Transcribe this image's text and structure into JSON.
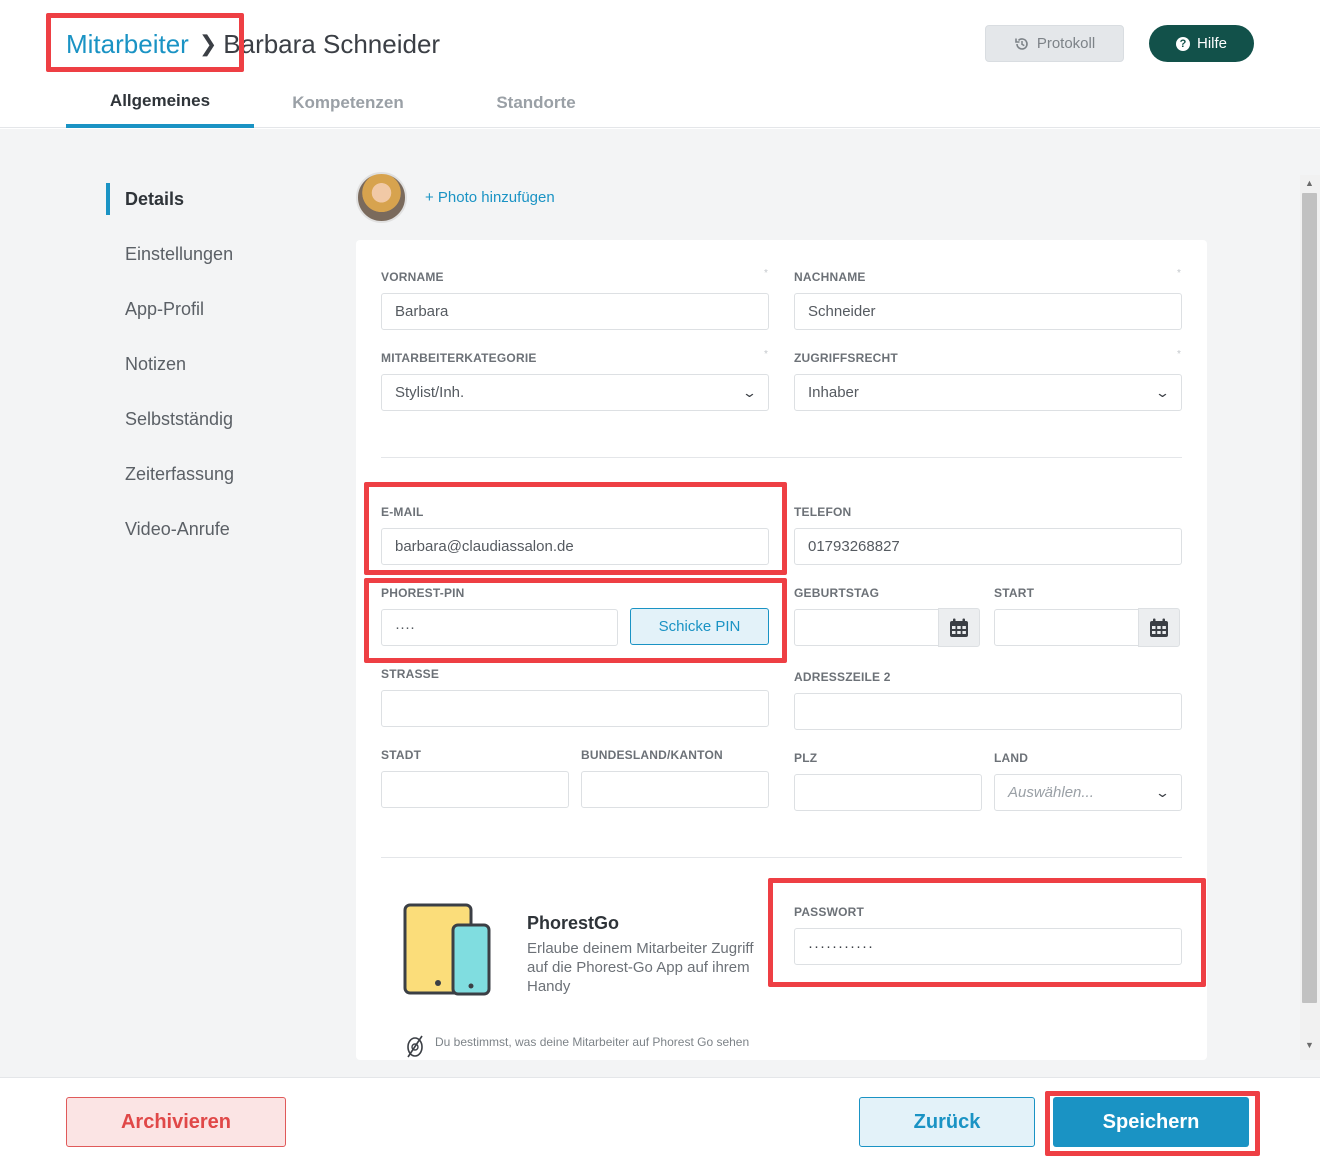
{
  "breadcrumb": {
    "root": "Mitarbeiter",
    "current": "Barbara Schneider"
  },
  "header": {
    "protokoll_label": "Protokoll",
    "hilfe_label": "Hilfe"
  },
  "tabs": [
    {
      "label": "Allgemeines",
      "active": true
    },
    {
      "label": "Kompetenzen"
    },
    {
      "label": "Standorte"
    }
  ],
  "sidebar": {
    "items": [
      {
        "label": "Details",
        "active": true
      },
      {
        "label": "Einstellungen"
      },
      {
        "label": "App-Profil"
      },
      {
        "label": "Notizen"
      },
      {
        "label": "Selbstständig"
      },
      {
        "label": "Zeiterfassung"
      },
      {
        "label": "Video-Anrufe"
      }
    ]
  },
  "photo": {
    "add_label": "+ Photo hinzufügen"
  },
  "form": {
    "vorname": {
      "label": "VORNAME",
      "value": "Barbara"
    },
    "nachname": {
      "label": "NACHNAME",
      "value": "Schneider"
    },
    "kategorie": {
      "label": "MITARBEITERKATEGORIE",
      "value": "Stylist/Inh."
    },
    "zugriff": {
      "label": "ZUGRIFFSRECHT",
      "value": "Inhaber"
    },
    "email": {
      "label": "E-MAIL",
      "value": "barbara@claudiassalon.de"
    },
    "telefon": {
      "label": "TELEFON",
      "value": "01793268827"
    },
    "pin": {
      "label": "PHOREST-PIN",
      "value": "····",
      "button": "Schicke PIN"
    },
    "geburtstag": {
      "label": "GEBURTSTAG",
      "value": ""
    },
    "start": {
      "label": "START",
      "value": ""
    },
    "strasse": {
      "label": "STRASSE",
      "value": ""
    },
    "adresse2": {
      "label": "ADRESSZEILE 2",
      "value": ""
    },
    "stadt": {
      "label": "STADT",
      "value": ""
    },
    "bundesland": {
      "label": "BUNDESLAND/KANTON",
      "value": ""
    },
    "plz": {
      "label": "PLZ",
      "value": ""
    },
    "land": {
      "label": "LAND",
      "placeholder": "Auswählen..."
    },
    "required_mark": "*"
  },
  "phorestgo": {
    "title": "PhorestGo",
    "description": "Erlaube deinem Mitarbeiter Zugriff auf die Phorest-Go App auf ihrem Handy",
    "passwort_label": "PASSWORT",
    "passwort_value": "···········",
    "note": "Du bestimmst, was deine Mitarbeiter auf Phorest Go sehen"
  },
  "footer": {
    "archiv_label": "Archivieren",
    "zurueck_label": "Zurück",
    "speichern_label": "Speichern"
  },
  "colors": {
    "accent": "#1a93c4",
    "highlight": "#ee3f44",
    "hilfe_bg": "#12514a",
    "danger": "#e04848"
  }
}
